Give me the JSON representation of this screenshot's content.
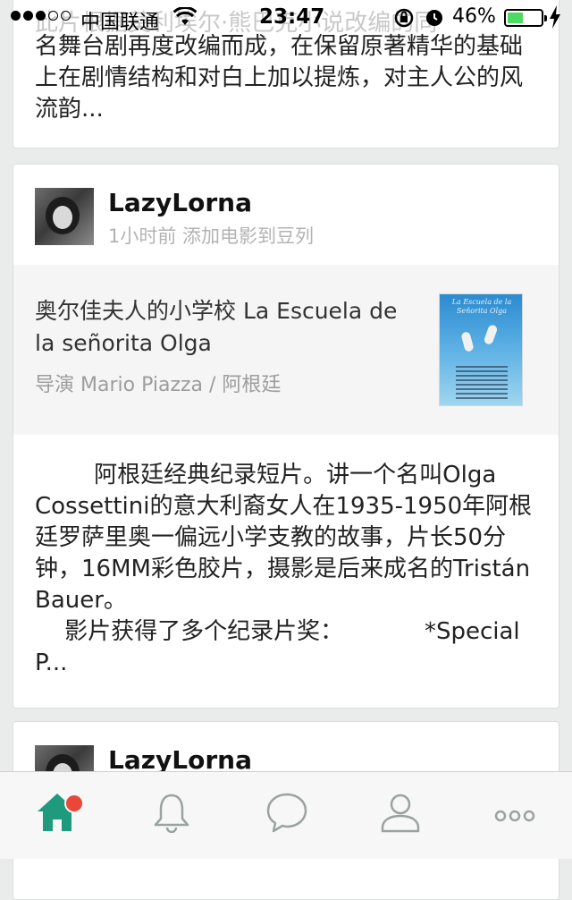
{
  "status_bar": {
    "carrier": "中国联通",
    "time": "23:47",
    "battery_percent": "46%",
    "battery_level": 0.46
  },
  "feed": {
    "top_card": {
      "faded_line": "此片根据莫利埃尔·熊巴克小说改编的同",
      "excerpt": "名舞台剧再度改编而成，在保留原著精华的基础上在剧情结构和对白上加以提炼，对主人公的风流韵..."
    },
    "main_card": {
      "username": "LazyLorna",
      "meta": "1小时前 添加电影到豆列",
      "movie_title": "奥尔佳夫人的小学校 La Escuela de la señorita Olga",
      "movie_director": "导演 Mario Piazza  / 阿根廷",
      "poster_title": "La Escuela de la Señorita Olga",
      "description": "        阿根廷经典纪录短片。讲一个名叫Olga Cossettini的意大利裔女人在1935-1950年阿根廷罗萨里奥一偏远小学支教的故事，片长50分钟，16MM彩色胶片，摄影是后来成名的Tristán Bauer。\n    影片获得了多个纪录片奖：           *Special P..."
    },
    "bottom_card": {
      "username": "LazyLorna"
    }
  },
  "tab_bar": {
    "accent_color": "#1f9a7c",
    "inactive_color": "#9aa3a0",
    "badge_color": "#e9473a",
    "tabs": [
      {
        "icon": "home-icon",
        "active": true,
        "badge": true
      },
      {
        "icon": "bell-icon",
        "active": false,
        "badge": false
      },
      {
        "icon": "chat-bubble-icon",
        "active": false,
        "badge": false
      },
      {
        "icon": "person-icon",
        "active": false,
        "badge": false
      },
      {
        "icon": "more-dots-icon",
        "active": false,
        "badge": false
      }
    ]
  }
}
